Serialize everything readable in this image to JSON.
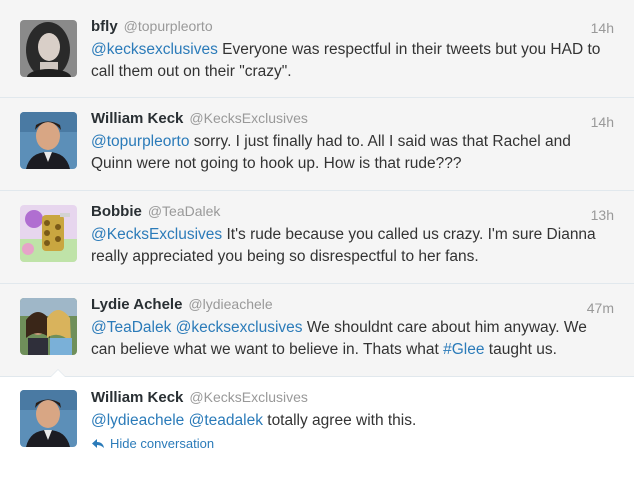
{
  "tweets": [
    {
      "name": "bfly",
      "handle": "@topurpleorto",
      "time": "14h",
      "avatar_icon": "woman-portrait-avatar",
      "text_parts": [
        {
          "t": "@kecksexclusives",
          "k": "mention"
        },
        {
          "t": " Everyone was respectful in their tweets but you HAD to call them out on their \"crazy\".",
          "k": "plain"
        }
      ]
    },
    {
      "name": "William Keck",
      "handle": "@KecksExclusives",
      "time": "14h",
      "avatar_icon": "man-portrait-avatar",
      "text_parts": [
        {
          "t": "@topurpleorto",
          "k": "mention"
        },
        {
          "t": " sorry. I just finally had to. All I said was that Rachel and Quinn were not going to hook up. How is that rude???",
          "k": "plain"
        }
      ]
    },
    {
      "name": "Bobbie",
      "handle": "@TeaDalek",
      "time": "13h",
      "avatar_icon": "cartoon-dalek-avatar",
      "text_parts": [
        {
          "t": "@KecksExclusives",
          "k": "mention"
        },
        {
          "t": " It's rude because you called us crazy. I'm sure Dianna really appreciated you being so disrespectful to her fans.",
          "k": "plain"
        }
      ]
    },
    {
      "name": "Lydie Achele",
      "handle": "@lydieachele",
      "time": "47m",
      "avatar_icon": "two-women-photo-avatar",
      "text_parts": [
        {
          "t": "@TeaDalek",
          "k": "mention"
        },
        {
          "t": " ",
          "k": "plain"
        },
        {
          "t": "@kecksexclusives",
          "k": "mention"
        },
        {
          "t": " We shouldnt care about him anyway. We can believe what we want to believe in. Thats what ",
          "k": "plain"
        },
        {
          "t": "#Glee",
          "k": "hashtag"
        },
        {
          "t": " taught us.",
          "k": "plain"
        }
      ]
    },
    {
      "name": "William Keck",
      "handle": "@KecksExclusives",
      "time": "",
      "avatar_icon": "man-portrait-avatar",
      "text_parts": [
        {
          "t": "@lydieachele",
          "k": "mention"
        },
        {
          "t": " ",
          "k": "plain"
        },
        {
          "t": "@teadalek",
          "k": "mention"
        },
        {
          "t": " totally agree with this.",
          "k": "plain"
        }
      ]
    }
  ],
  "hide_conversation_label": "Hide conversation",
  "colors": {
    "link": "#2b7bb9",
    "muted": "#999999",
    "text": "#333333",
    "name": "#292f33"
  }
}
